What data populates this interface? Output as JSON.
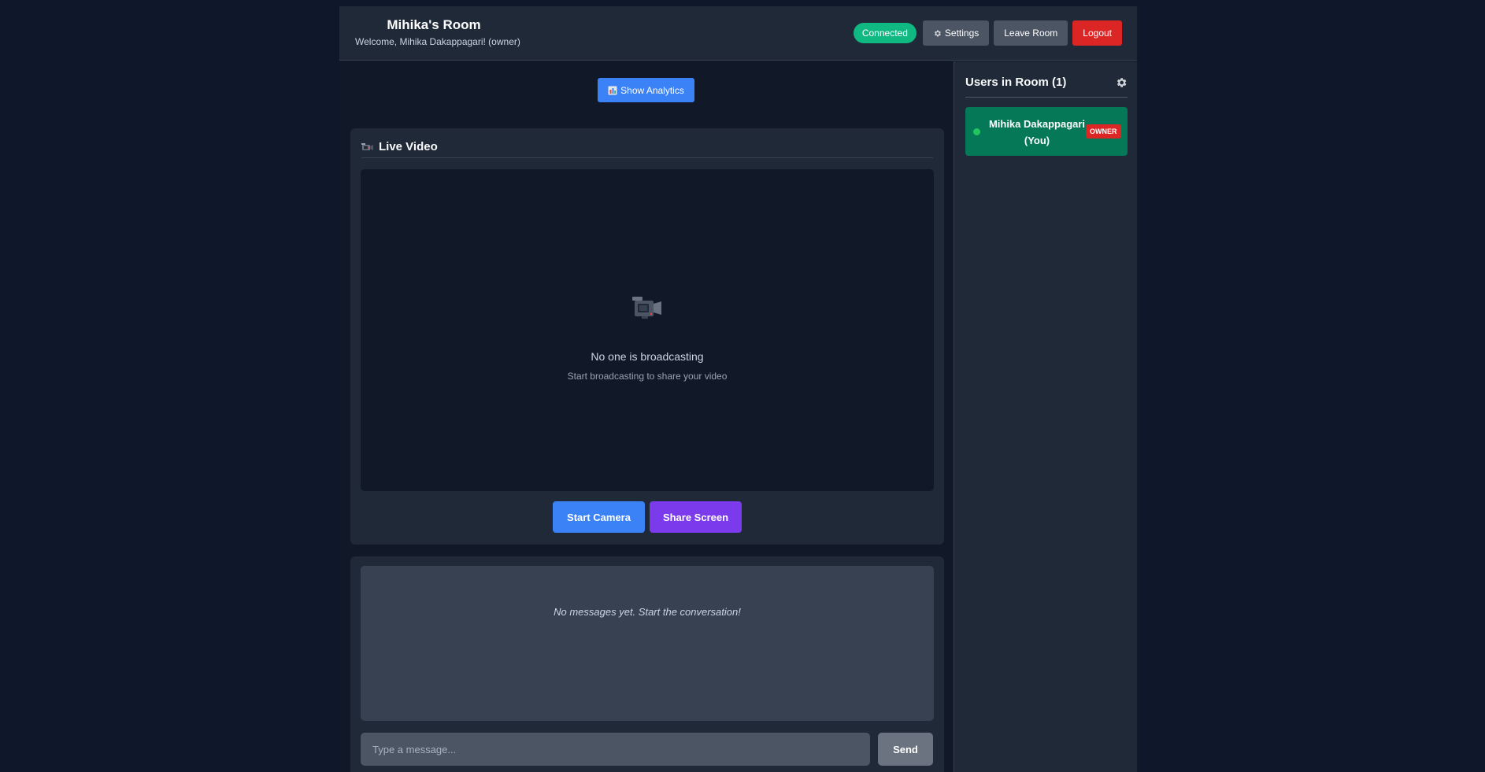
{
  "header": {
    "title": "Mihika's Room",
    "welcome": "Welcome, Mihika Dakappagari! (owner)",
    "status": "Connected",
    "settings_label": "Settings",
    "leave_label": "Leave Room",
    "logout_label": "Logout"
  },
  "main": {
    "analytics_label": "Show Analytics",
    "video": {
      "title": "Live Video",
      "empty_title": "No one is broadcasting",
      "empty_subtitle": "Start broadcasting to share your video",
      "start_camera_label": "Start Camera",
      "share_screen_label": "Share Screen"
    },
    "chat": {
      "empty_text": "No messages yet. Start the conversation!",
      "input_placeholder": "Type a message...",
      "input_value": "",
      "send_label": "Send"
    }
  },
  "sidebar": {
    "title": "Users in Room (1)",
    "users": [
      {
        "name": "Mihika Dakappagari (You)",
        "role_badge": "OWNER",
        "online": true
      }
    ]
  },
  "icons": {
    "settings": "gear-icon",
    "analytics": "bar-chart-icon",
    "video": "video-camera-icon",
    "sidebar_settings": "gear-icon"
  },
  "colors": {
    "connected": "#10b981",
    "logout": "#dc2626",
    "primary": "#3b82f6",
    "share": "#7c3aed",
    "user_card": "#047857",
    "owner_badge": "#dc2626"
  }
}
